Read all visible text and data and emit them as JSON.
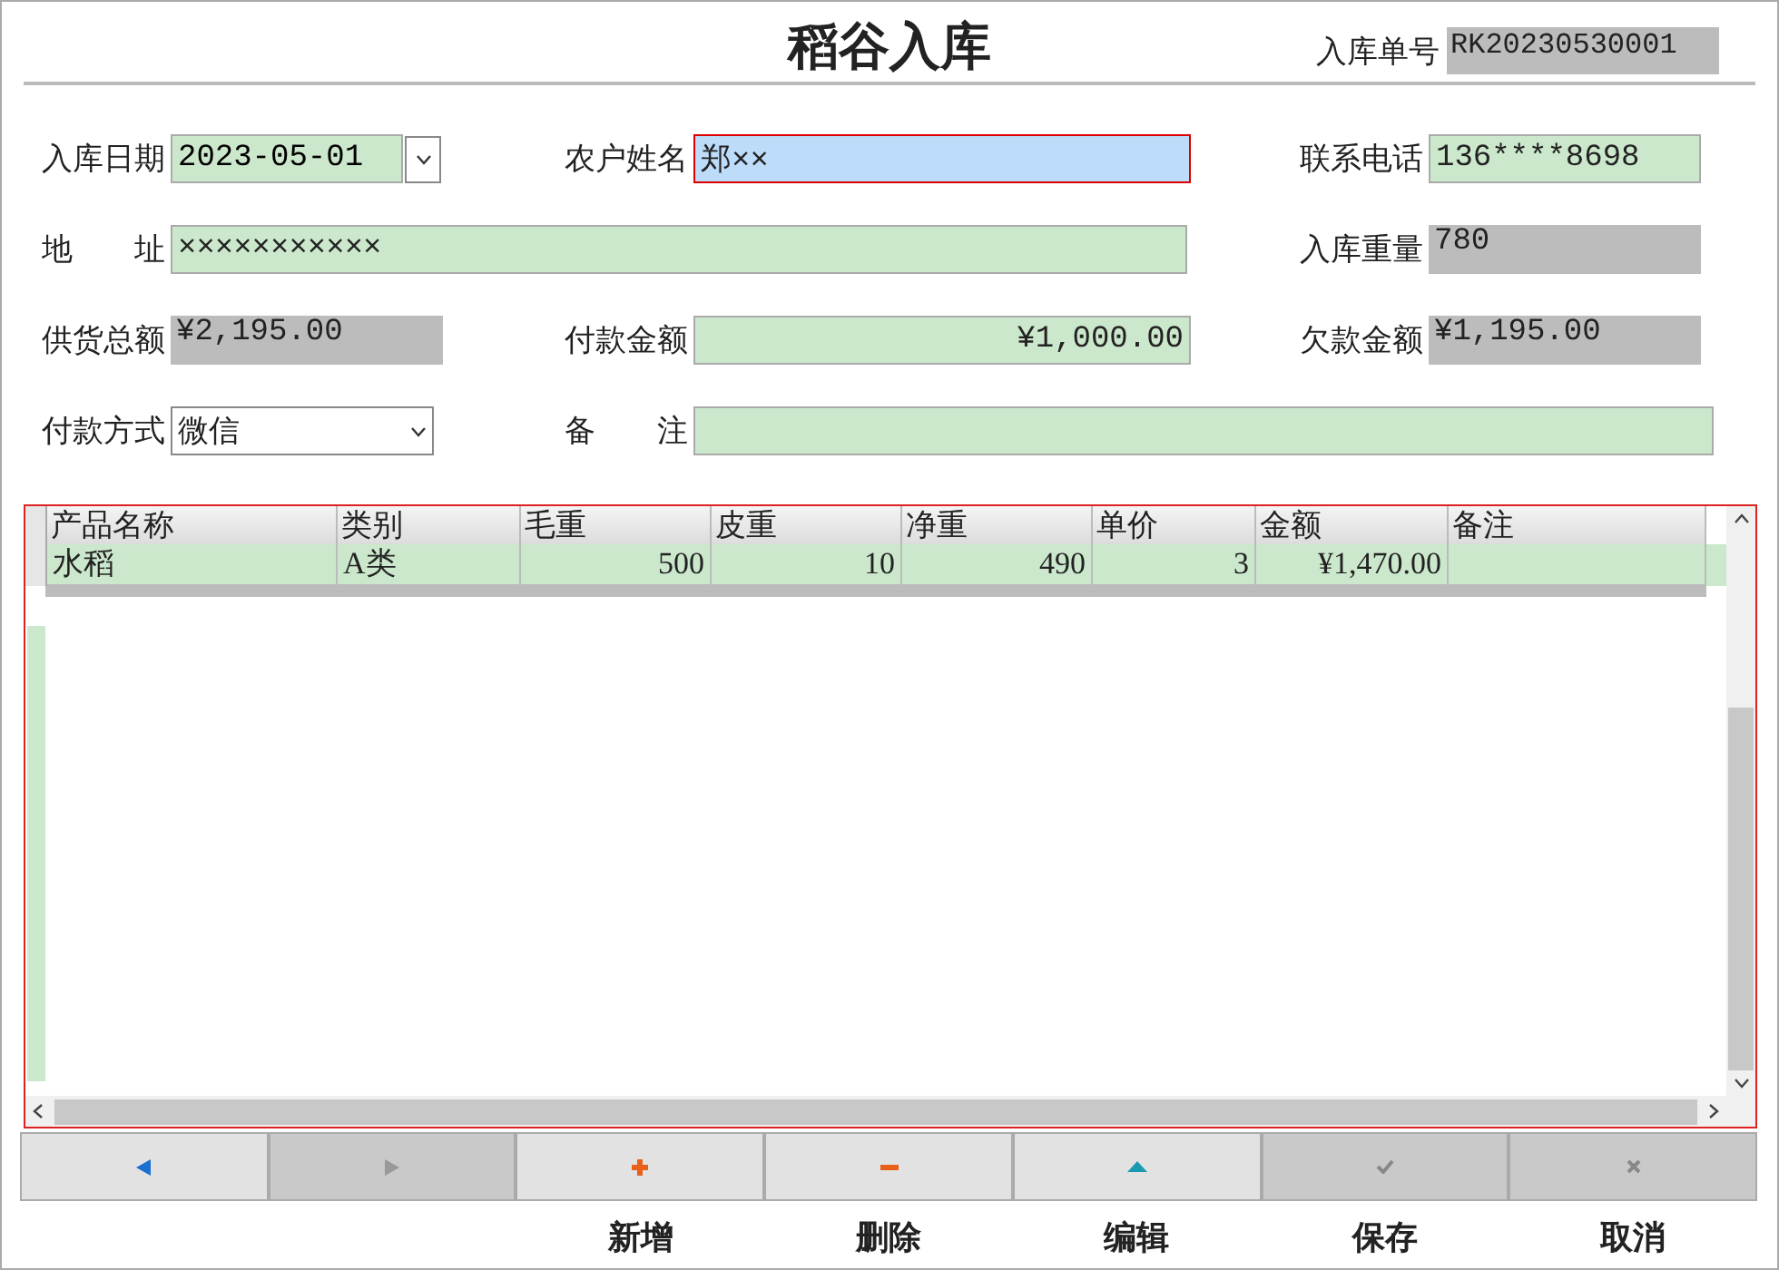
{
  "title": "稻谷入库",
  "order_no": {
    "label": "入库单号",
    "value": "RK20230530001"
  },
  "form_rows": [
    [
      {
        "label": "入库日期",
        "value": "2023-05-01",
        "kind": "date",
        "focused": false
      },
      {
        "label": "农户姓名",
        "value": "郑××",
        "kind": "text",
        "focused": true
      },
      {
        "label": "联系电话",
        "value": "136****8698",
        "kind": "text",
        "focused": false
      }
    ],
    [
      {
        "label": "地　　址",
        "value": "×××××××××××",
        "kind": "text",
        "focused": false
      },
      {
        "label": "入库重量",
        "value": "780",
        "kind": "readonly"
      }
    ],
    [
      {
        "label": "供货总额",
        "value": "¥2,195.00",
        "kind": "readonly"
      },
      {
        "label": "付款金额",
        "value": "¥1,000.00",
        "kind": "amount",
        "focused": false
      },
      {
        "label": "欠款金额",
        "value": "¥1,195.00",
        "kind": "readonly"
      }
    ],
    [
      {
        "label": "付款方式",
        "value": "微信",
        "kind": "select",
        "focused": false
      },
      {
        "label": "备　　注",
        "kind": "text",
        "focused": false
      }
    ]
  ],
  "table": {
    "columns": [
      {
        "label": "产品名称",
        "kind": "text"
      },
      {
        "label": "类别",
        "kind": "text"
      },
      {
        "label": "毛重",
        "kind": "number"
      },
      {
        "label": "皮重",
        "kind": "number"
      },
      {
        "label": "净重",
        "kind": "number"
      },
      {
        "label": "单价",
        "kind": "number"
      },
      {
        "label": "金额",
        "kind": "number"
      },
      {
        "label": "备注",
        "kind": "text"
      }
    ],
    "rows": [
      [
        "水稻",
        "A类",
        "500",
        "10",
        "490",
        "3",
        "¥1,470.00",
        ""
      ]
    ]
  },
  "buttons": [
    {
      "kind": "prev",
      "disabled": false
    },
    {
      "kind": "next",
      "disabled": true
    },
    {
      "kind": "add",
      "label": "新增",
      "disabled": false
    },
    {
      "kind": "delete",
      "label": "删除",
      "disabled": false
    },
    {
      "kind": "edit",
      "label": "编辑",
      "disabled": false
    },
    {
      "kind": "save",
      "label": "保存",
      "disabled": true
    },
    {
      "kind": "cancel",
      "label": "取消",
      "disabled": true
    }
  ]
}
